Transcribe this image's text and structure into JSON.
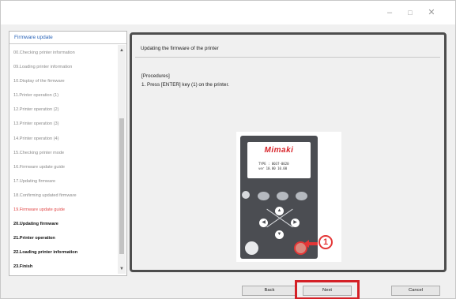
{
  "window": {
    "minimize_glyph": "–",
    "maximize_glyph": "□",
    "close_glyph": "✕"
  },
  "sidebar": {
    "title": "Firmware update",
    "steps": [
      "00.Checking printer information",
      "09.Loading printer information",
      "10.Display of the firmware",
      "11.Printer operation (1)",
      "12.Printer operation (2)",
      "13.Printer operation (3)",
      "14.Printer operation (4)",
      "15.Checking printer mode",
      "16.Firmware update guide",
      "17.Updating firmware",
      "18.Confirming updated firmware",
      "19.Firmware update guide",
      "20.Updating firmware",
      "21.Printer operation",
      "22.Loading printer information",
      "23.Finish"
    ],
    "current_step_index": 11,
    "scroll_up_glyph": "▲",
    "scroll_down_glyph": "▼"
  },
  "main": {
    "heading": "Updating the firmware of the printer",
    "procedures_label": "[Procedures]",
    "step_1": "1.  Press [ENTER] key (1) on the printer."
  },
  "printer": {
    "brand": "Mimaki",
    "lcd_line_1": "TYPE : 0037-0020",
    "lcd_line_2": "ver  10.00  10.00",
    "arrow_up": "▲",
    "arrow_left": "◀",
    "arrow_right": "▶",
    "arrow_down": "▼",
    "callout": "1"
  },
  "footer": {
    "back_label": "Back",
    "next_label": "Next",
    "cancel_label": "Cancel"
  },
  "colors": {
    "current_step": "#e24a4a",
    "sidebar_title": "#2a64b8",
    "highlight": "#d42026",
    "panel_border": "#4d4d4d"
  }
}
